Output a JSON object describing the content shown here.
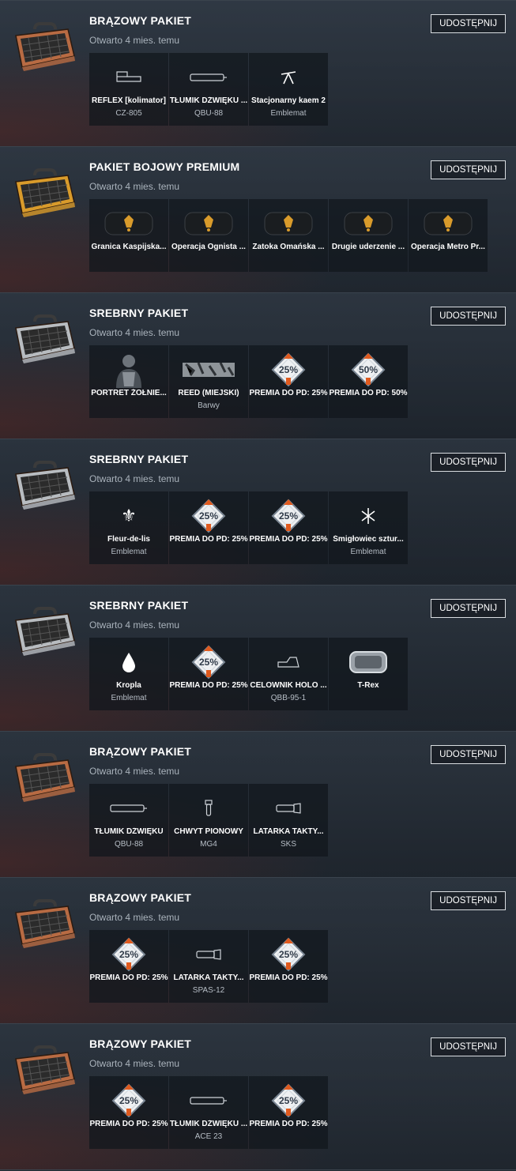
{
  "share_label": "UDOSTĘPNIJ",
  "colors": {
    "bronze": "#b86b43",
    "gold": "#d99b2b",
    "silver": "#b8bcc0",
    "xp_orange": "#e05a1e"
  },
  "packs": [
    {
      "title": "BRĄZOWY PAKIET",
      "date": "Otwarto 4 mies. temu",
      "case": "bronze",
      "items": [
        {
          "icon": "reflex-sight-icon",
          "name": "REFLEX [kolimator]",
          "sub": "CZ-805"
        },
        {
          "icon": "suppressor-icon",
          "name": "TŁUMIK DŹWIĘKU ...",
          "sub": "QBU-88"
        },
        {
          "icon": "mounted-gun-emblem-icon",
          "name": "Stacjonarny kaem 2",
          "sub": "Emblemat"
        }
      ]
    },
    {
      "title": "PAKIET BOJOWY PREMIUM",
      "date": "Otwarto 4 mies. temu",
      "case": "gold",
      "items": [
        {
          "icon": "dogtag-gold-icon",
          "name": "Granica Kaspijska...",
          "sub": ""
        },
        {
          "icon": "dogtag-gold-icon",
          "name": "Operacja Ognista ...",
          "sub": ""
        },
        {
          "icon": "dogtag-gold-icon",
          "name": "Zatoka Omańska ...",
          "sub": ""
        },
        {
          "icon": "dogtag-gold-icon",
          "name": "Drugie uderzenie ...",
          "sub": ""
        },
        {
          "icon": "dogtag-gold-icon",
          "name": "Operacja Metro Pr...",
          "sub": ""
        }
      ]
    },
    {
      "title": "SREBRNY PAKIET",
      "date": "Otwarto 4 mies. temu",
      "case": "silver",
      "items": [
        {
          "icon": "soldier-portrait-icon",
          "name": "PORTRET ŻOŁNIE...",
          "sub": ""
        },
        {
          "icon": "camo-pattern-icon",
          "name": "REED (MIEJSKI)",
          "sub": "Barwy"
        },
        {
          "icon": "xp-boost-icon",
          "badge": "25%",
          "name": "PREMIA DO PD: 25%",
          "sub": ""
        },
        {
          "icon": "xp-boost-icon",
          "badge": "50%",
          "name": "PREMIA DO PD: 50%",
          "sub": ""
        }
      ]
    },
    {
      "title": "SREBRNY PAKIET",
      "date": "Otwarto 4 mies. temu",
      "case": "silver",
      "items": [
        {
          "icon": "fleur-de-lis-icon",
          "name": "Fleur-de-lis",
          "sub": "Emblemat"
        },
        {
          "icon": "xp-boost-icon",
          "badge": "25%",
          "name": "PREMIA DO PD: 25%",
          "sub": ""
        },
        {
          "icon": "xp-boost-icon",
          "badge": "25%",
          "name": "PREMIA DO PD: 25%",
          "sub": ""
        },
        {
          "icon": "helicopter-emblem-icon",
          "name": "Śmigłowiec sztur...",
          "sub": "Emblemat"
        }
      ]
    },
    {
      "title": "SREBRNY PAKIET",
      "date": "Otwarto 4 mies. temu",
      "case": "silver",
      "items": [
        {
          "icon": "drop-emblem-icon",
          "name": "Kropla",
          "sub": "Emblemat"
        },
        {
          "icon": "xp-boost-icon",
          "badge": "25%",
          "name": "PREMIA DO PD: 25%",
          "sub": ""
        },
        {
          "icon": "holo-sight-icon",
          "name": "CELOWNIK HOLO ...",
          "sub": "QBB-95-1"
        },
        {
          "icon": "dogtag-silver-icon",
          "name": "T-Rex",
          "sub": ""
        }
      ]
    },
    {
      "title": "BRĄZOWY PAKIET",
      "date": "Otwarto 4 mies. temu",
      "case": "bronze",
      "items": [
        {
          "icon": "suppressor-icon",
          "name": "TŁUMIK DŹWIĘKU",
          "sub": "QBU-88"
        },
        {
          "icon": "vertical-grip-icon",
          "name": "CHWYT PIONOWY",
          "sub": "MG4"
        },
        {
          "icon": "flashlight-icon",
          "name": "LATARKA TAKTY...",
          "sub": "SKS"
        }
      ]
    },
    {
      "title": "BRĄZOWY PAKIET",
      "date": "Otwarto 4 mies. temu",
      "case": "bronze",
      "items": [
        {
          "icon": "xp-boost-icon",
          "badge": "25%",
          "name": "PREMIA DO PD: 25%",
          "sub": ""
        },
        {
          "icon": "flashlight-icon",
          "name": "LATARKA TAKTY...",
          "sub": "SPAS-12"
        },
        {
          "icon": "xp-boost-icon",
          "badge": "25%",
          "name": "PREMIA DO PD: 25%",
          "sub": ""
        }
      ]
    },
    {
      "title": "BRĄZOWY PAKIET",
      "date": "Otwarto 4 mies. temu",
      "case": "bronze",
      "items": [
        {
          "icon": "xp-boost-icon",
          "badge": "25%",
          "name": "PREMIA DO PD: 25%",
          "sub": ""
        },
        {
          "icon": "suppressor-icon",
          "name": "TŁUMIK DŹWIĘKU ...",
          "sub": "ACE 23"
        },
        {
          "icon": "xp-boost-icon",
          "badge": "25%",
          "name": "PREMIA DO PD: 25%",
          "sub": ""
        }
      ]
    }
  ]
}
